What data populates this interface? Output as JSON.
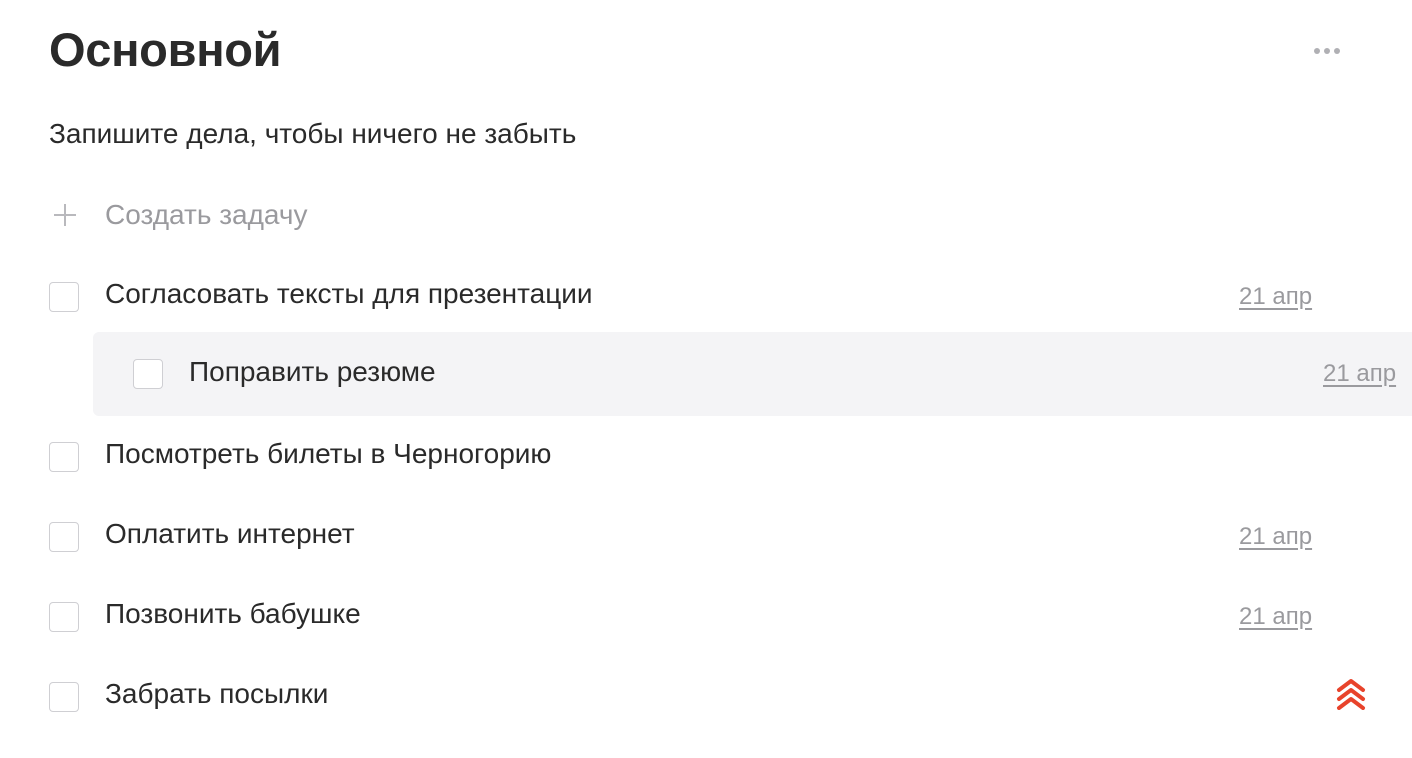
{
  "header": {
    "title": "Основной",
    "more_icon": "more-horizontal-icon"
  },
  "subtitle": "Запишите дела, чтобы ничего не забыть",
  "create_task": {
    "label": "Создать задачу",
    "icon": "plus-icon"
  },
  "tasks": [
    {
      "label": "Согласовать тексты для презентации",
      "date": "21 апр",
      "done": false
    },
    {
      "label": "Поправить резюме",
      "date": "21 апр",
      "done": false,
      "subtask": true
    },
    {
      "label": "Посмотреть билеты в Черногорию",
      "date": "",
      "done": false
    },
    {
      "label": "Оплатить интернет",
      "date": "21 апр",
      "done": false
    },
    {
      "label": "Позвонить бабушке",
      "date": "21 апр",
      "done": false
    },
    {
      "label": "Забрать посылки",
      "date": "",
      "done": false,
      "priority": "high",
      "priority_icon": "high-priority-chevrons-icon"
    }
  ],
  "colors": {
    "text": "#2a2a2a",
    "muted": "#9a9a9e",
    "subtask_background": "#f4f4f6",
    "priority": "#e8432b"
  }
}
